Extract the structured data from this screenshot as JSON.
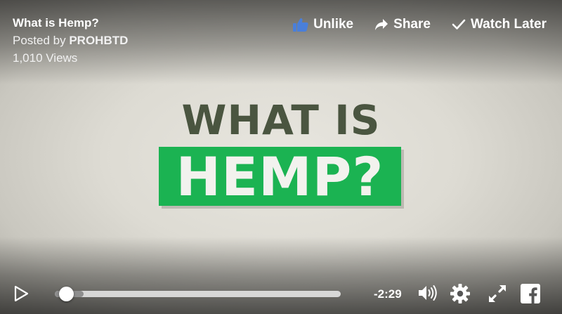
{
  "video": {
    "title": "What is Hemp?",
    "posted_prefix": "Posted by ",
    "posted_by": "PROHBTD",
    "views": "1,010 Views"
  },
  "actions": {
    "unlike": "Unlike",
    "share": "Share",
    "watch_later": "Watch Later"
  },
  "slide": {
    "line1": "WHAT IS",
    "line2": "HEMP?"
  },
  "controls": {
    "time_remaining": "-2:29",
    "progress_fraction": 0.02,
    "buffered_fraction": 0.1
  },
  "colors": {
    "like_blue": "#4a7fd9",
    "hemp_green": "#1bb352",
    "headline_olive": "#4a5540"
  },
  "icons": [
    "thumbs-up-icon",
    "share-arrow-icon",
    "checkmark-icon",
    "play-icon",
    "volume-icon",
    "gear-icon",
    "fullscreen-icon",
    "facebook-icon"
  ]
}
